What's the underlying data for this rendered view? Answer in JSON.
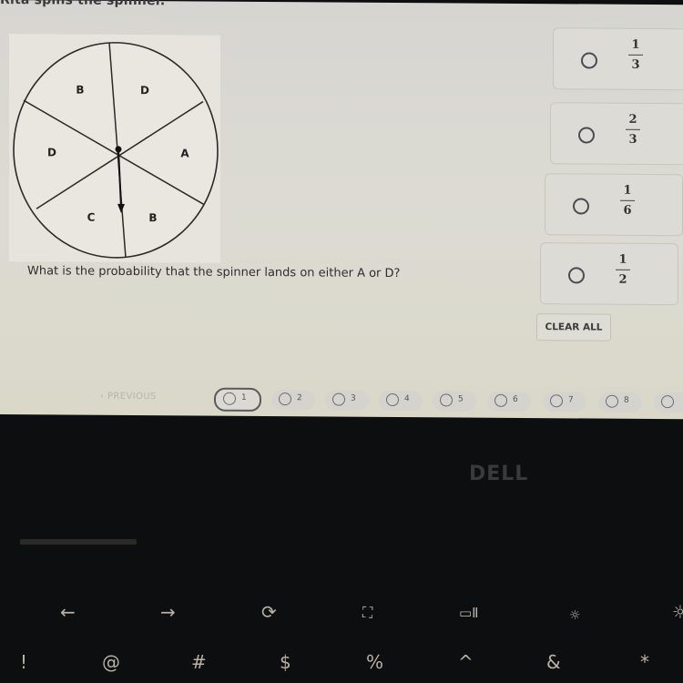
{
  "question": {
    "intro": "Rita spins the spinner.",
    "prompt": "What is the probability that the spinner lands on either A or D?"
  },
  "spinner": {
    "sections": [
      "B",
      "D",
      "A",
      "B",
      "C",
      "D"
    ],
    "center_marker": "arrow-pointer"
  },
  "options": [
    {
      "numerator": "1",
      "denominator": "3"
    },
    {
      "numerator": "2",
      "denominator": "3"
    },
    {
      "numerator": "1",
      "denominator": "6"
    },
    {
      "numerator": "1",
      "denominator": "2"
    }
  ],
  "clear_all_label": "CLEAR ALL",
  "navigation": {
    "previous_label": "PREVIOUS",
    "previous_icon": "chevron-left-icon",
    "questions": [
      "1",
      "2",
      "3",
      "4",
      "5",
      "6",
      "7",
      "8"
    ],
    "active_question": "1"
  },
  "laptop": {
    "brand": "DELL",
    "function_keys": [
      "←",
      "→",
      "⟳",
      "⛶",
      "▭Ⅱ",
      "☼",
      "☼"
    ],
    "number_row": [
      "!",
      "@",
      "#",
      "$",
      "%",
      "^",
      "&",
      "*"
    ]
  }
}
